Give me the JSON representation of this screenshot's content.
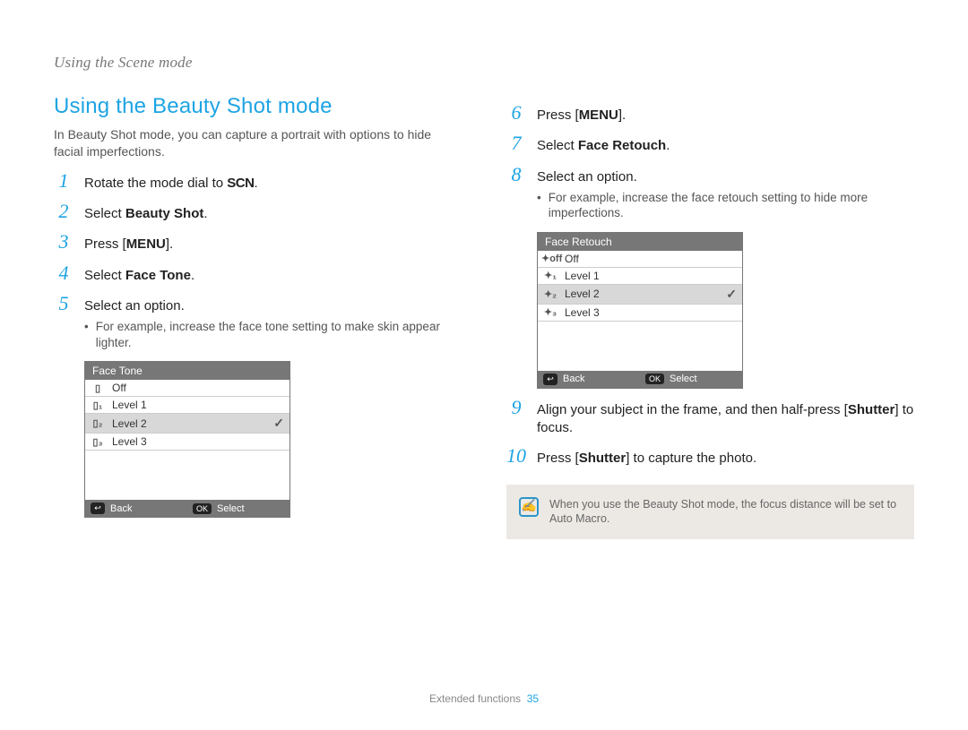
{
  "header": "Using the Scene mode",
  "section_title": "Using the Beauty Shot mode",
  "section_intro": "In Beauty Shot mode, you can capture a portrait with options to hide facial imperfections.",
  "left_steps": {
    "s1": {
      "num": "1",
      "pre": "Rotate the mode dial to ",
      "scn": "SCN",
      "post": "."
    },
    "s2": {
      "num": "2",
      "pre": "Select ",
      "bold": "Beauty Shot",
      "post": "."
    },
    "s3": {
      "num": "3",
      "pre": "Press [",
      "bold": "MENU",
      "post": "]."
    },
    "s4": {
      "num": "4",
      "pre": "Select ",
      "bold": "Face Tone",
      "post": "."
    },
    "s5": {
      "num": "5",
      "text": "Select an option.",
      "bullet": "For example, increase the face tone setting to make skin appear lighter."
    }
  },
  "right_steps": {
    "s6": {
      "num": "6",
      "pre": "Press [",
      "bold": "MENU",
      "post": "]."
    },
    "s7": {
      "num": "7",
      "pre": "Select ",
      "bold": "Face Retouch",
      "post": "."
    },
    "s8": {
      "num": "8",
      "text": "Select an option.",
      "bullet": "For example, increase the face retouch setting to hide more imperfections."
    },
    "s9": {
      "num": "9",
      "pre": "Align your subject in the frame, and then half-press [",
      "bold": "Shutter",
      "post": "] to focus."
    },
    "s10": {
      "num": "10",
      "pre": "Press [",
      "bold": "Shutter",
      "post": "] to capture the photo."
    }
  },
  "menu_tone": {
    "title": "Face Tone",
    "rows": [
      {
        "icon": "▯",
        "label": "Off"
      },
      {
        "icon": "▯₁",
        "label": "Level 1"
      },
      {
        "icon": "▯₂",
        "label": "Level 2",
        "selected": true
      },
      {
        "icon": "▯₃",
        "label": "Level 3"
      }
    ],
    "back": "Back",
    "select": "Select",
    "back_icon": "↩",
    "ok_icon": "OK"
  },
  "menu_retouch": {
    "title": "Face Retouch",
    "rows": [
      {
        "icon": "✦off",
        "label": "Off"
      },
      {
        "icon": "✦₁",
        "label": "Level 1"
      },
      {
        "icon": "✦₂",
        "label": "Level 2",
        "selected": true
      },
      {
        "icon": "✦₃",
        "label": "Level 3"
      }
    ],
    "back": "Back",
    "select": "Select",
    "back_icon": "↩",
    "ok_icon": "OK"
  },
  "note_text": "When you use the Beauty Shot mode, the focus distance will be set to Auto Macro.",
  "footer": {
    "label": "Extended functions",
    "page": "35"
  },
  "check": "✓",
  "bullet_dot": "•"
}
